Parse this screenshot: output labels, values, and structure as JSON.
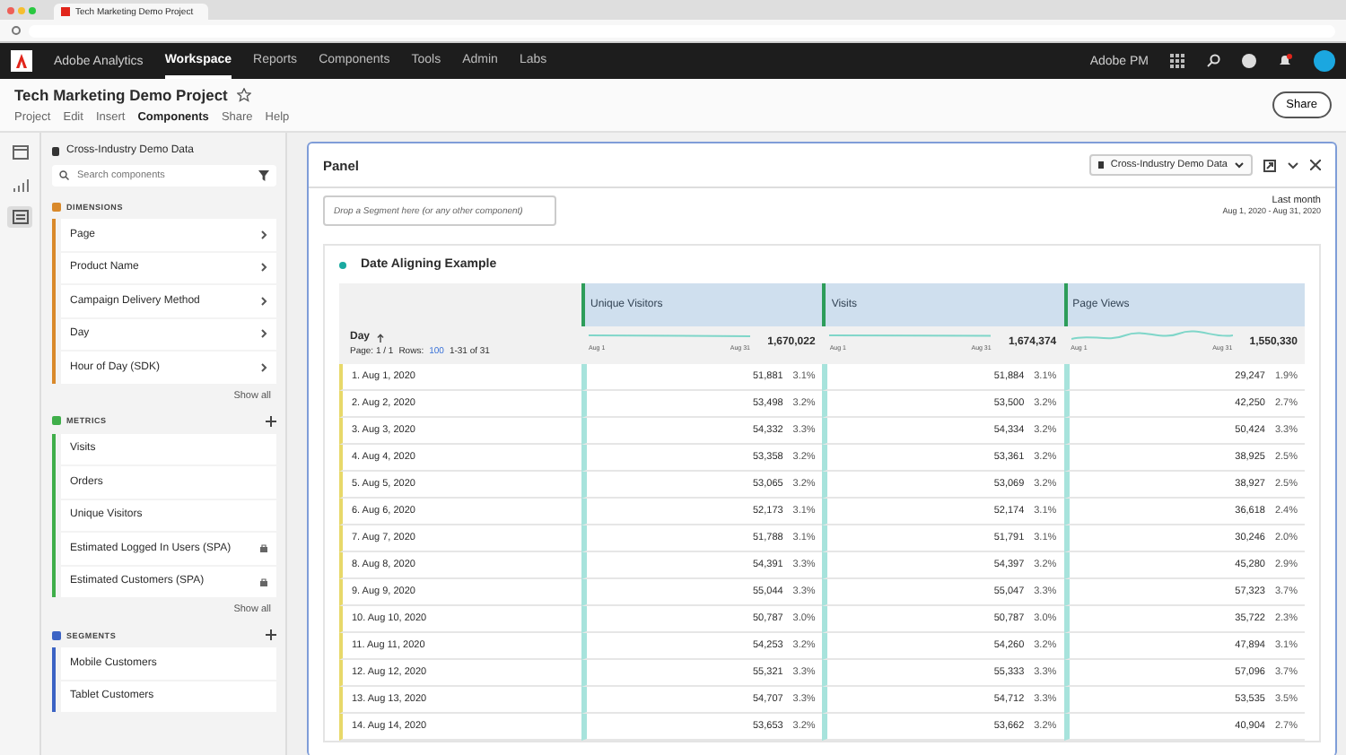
{
  "browser": {
    "tab_title": "Tech Marketing Demo Project"
  },
  "top_nav": {
    "product": "Adobe Analytics",
    "items": [
      {
        "label": "Workspace",
        "selected": true
      },
      {
        "label": "Reports",
        "selected": false
      },
      {
        "label": "Components",
        "selected": false
      },
      {
        "label": "Tools",
        "selected": false
      },
      {
        "label": "Admin",
        "selected": false
      },
      {
        "label": "Labs",
        "selected": false
      }
    ],
    "org": "Adobe PM"
  },
  "project": {
    "title": "Tech Marketing Demo Project",
    "menu": [
      {
        "label": "Project",
        "selected": false
      },
      {
        "label": "Edit",
        "selected": false
      },
      {
        "label": "Insert",
        "selected": false
      },
      {
        "label": "Components",
        "selected": true
      },
      {
        "label": "Share",
        "selected": false
      },
      {
        "label": "Help",
        "selected": false
      }
    ],
    "share": "Share"
  },
  "sidebar": {
    "data_source": "Cross-Industry Demo Data",
    "search_placeholder": "Search components",
    "sections": [
      {
        "kind": "dimension",
        "title": "DIMENSIONS",
        "color": "#d9892b",
        "items": [
          {
            "label": "Page"
          },
          {
            "label": "Product Name"
          },
          {
            "label": "Campaign Delivery Method"
          },
          {
            "label": "Day"
          },
          {
            "label": "Hour of Day (SDK)"
          }
        ],
        "show_all": "Show all"
      },
      {
        "kind": "metric",
        "title": "METRICS",
        "color": "#3fae4a",
        "items": [
          {
            "label": "Visits",
            "locked": false
          },
          {
            "label": "Orders",
            "locked": false
          },
          {
            "label": "Unique Visitors",
            "locked": false
          },
          {
            "label": "Estimated Logged In Users (SPA)",
            "locked": true
          },
          {
            "label": "Estimated Customers (SPA)",
            "locked": true
          }
        ],
        "show_all": "Show all"
      },
      {
        "kind": "segment",
        "title": "SEGMENTS",
        "color": "#3b63c4",
        "items": [
          {
            "label": "Mobile Customers"
          },
          {
            "label": "Tablet Customers"
          }
        ]
      }
    ]
  },
  "panel": {
    "title": "Panel",
    "data_source": "Cross-Industry Demo Data",
    "segment_placeholder": "Drop a Segment here (or any other component)",
    "date_label": "Last month",
    "date_range": "Aug 1, 2020 - Aug 31, 2020",
    "table": {
      "title": "Date Aligning Example",
      "dimension": "Day",
      "page": "Page: 1 / 1",
      "rows_label": "Rows:",
      "rows_count": "100",
      "range": "1-31 of 31",
      "columns": [
        {
          "name": "Unique Visitors",
          "total": "1,670,022",
          "start": "Aug 1",
          "end": "Aug 31"
        },
        {
          "name": "Visits",
          "total": "1,674,374",
          "start": "Aug 1",
          "end": "Aug 31"
        },
        {
          "name": "Page Views",
          "total": "1,550,330",
          "start": "Aug 1",
          "end": "Aug 31"
        }
      ],
      "rows": [
        {
          "label": "1. Aug 1, 2020",
          "cells": [
            [
              "51,881",
              "3.1%"
            ],
            [
              "51,884",
              "3.1%"
            ],
            [
              "29,247",
              "1.9%"
            ]
          ]
        },
        {
          "label": "2. Aug 2, 2020",
          "cells": [
            [
              "53,498",
              "3.2%"
            ],
            [
              "53,500",
              "3.2%"
            ],
            [
              "42,250",
              "2.7%"
            ]
          ]
        },
        {
          "label": "3. Aug 3, 2020",
          "cells": [
            [
              "54,332",
              "3.3%"
            ],
            [
              "54,334",
              "3.2%"
            ],
            [
              "50,424",
              "3.3%"
            ]
          ]
        },
        {
          "label": "4. Aug 4, 2020",
          "cells": [
            [
              "53,358",
              "3.2%"
            ],
            [
              "53,361",
              "3.2%"
            ],
            [
              "38,925",
              "2.5%"
            ]
          ]
        },
        {
          "label": "5. Aug 5, 2020",
          "cells": [
            [
              "53,065",
              "3.2%"
            ],
            [
              "53,069",
              "3.2%"
            ],
            [
              "38,927",
              "2.5%"
            ]
          ]
        },
        {
          "label": "6. Aug 6, 2020",
          "cells": [
            [
              "52,173",
              "3.1%"
            ],
            [
              "52,174",
              "3.1%"
            ],
            [
              "36,618",
              "2.4%"
            ]
          ]
        },
        {
          "label": "7. Aug 7, 2020",
          "cells": [
            [
              "51,788",
              "3.1%"
            ],
            [
              "51,791",
              "3.1%"
            ],
            [
              "30,246",
              "2.0%"
            ]
          ]
        },
        {
          "label": "8. Aug 8, 2020",
          "cells": [
            [
              "54,391",
              "3.3%"
            ],
            [
              "54,397",
              "3.2%"
            ],
            [
              "45,280",
              "2.9%"
            ]
          ]
        },
        {
          "label": "9. Aug 9, 2020",
          "cells": [
            [
              "55,044",
              "3.3%"
            ],
            [
              "55,047",
              "3.3%"
            ],
            [
              "57,323",
              "3.7%"
            ]
          ]
        },
        {
          "label": "10. Aug 10, 2020",
          "cells": [
            [
              "50,787",
              "3.0%"
            ],
            [
              "50,787",
              "3.0%"
            ],
            [
              "35,722",
              "2.3%"
            ]
          ]
        },
        {
          "label": "11. Aug 11, 2020",
          "cells": [
            [
              "54,253",
              "3.2%"
            ],
            [
              "54,260",
              "3.2%"
            ],
            [
              "47,894",
              "3.1%"
            ]
          ]
        },
        {
          "label": "12. Aug 12, 2020",
          "cells": [
            [
              "55,321",
              "3.3%"
            ],
            [
              "55,333",
              "3.3%"
            ],
            [
              "57,096",
              "3.7%"
            ]
          ]
        },
        {
          "label": "13. Aug 13, 2020",
          "cells": [
            [
              "54,707",
              "3.3%"
            ],
            [
              "54,712",
              "3.3%"
            ],
            [
              "53,535",
              "3.5%"
            ]
          ]
        },
        {
          "label": "14. Aug 14, 2020",
          "cells": [
            [
              "53,653",
              "3.2%"
            ],
            [
              "53,662",
              "3.2%"
            ],
            [
              "40,904",
              "2.7%"
            ]
          ]
        }
      ]
    }
  }
}
